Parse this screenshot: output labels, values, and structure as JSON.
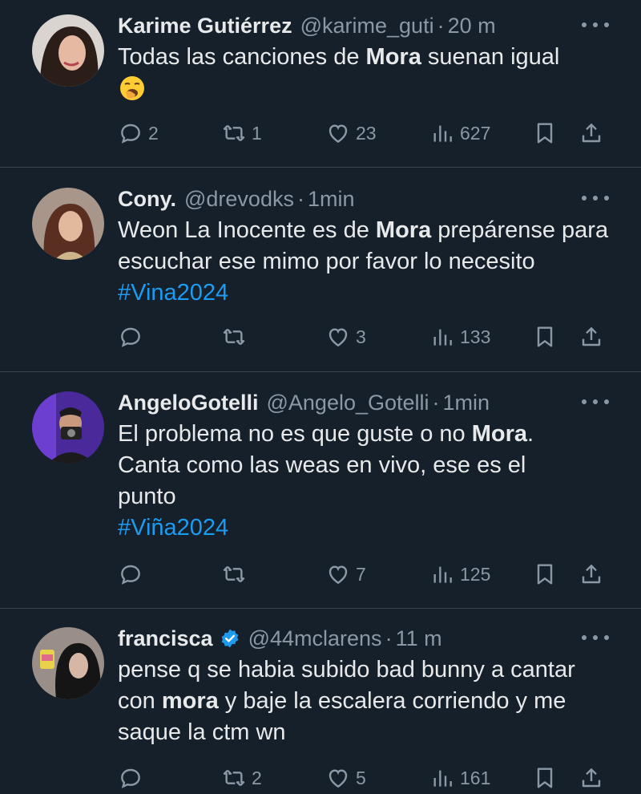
{
  "tweets": [
    {
      "name": "Karime Gutiérrez",
      "handle": "@karime_guti",
      "sep": "·",
      "time": "20 m",
      "verified": false,
      "text_parts": [
        {
          "t": "Todas las canciones de ",
          "s": "normal"
        },
        {
          "t": "Mora",
          "s": "bold"
        },
        {
          "t": " suenan igual",
          "s": "normal"
        }
      ],
      "emoji": "yawning-face-emoji",
      "replies": "2",
      "retweets": "1",
      "likes": "23",
      "views": "627"
    },
    {
      "name": "Cony.",
      "handle": "@drevodks",
      "sep": "·",
      "time": "1min",
      "verified": false,
      "text_parts": [
        {
          "t": "Weon La Inocente es de ",
          "s": "normal"
        },
        {
          "t": "Mora",
          "s": "bold"
        },
        {
          "t": " prepárense para escuchar ese mimo por favor lo necesito  ",
          "s": "normal"
        },
        {
          "t": "#Vina2024",
          "s": "hashtag"
        }
      ],
      "replies": "",
      "retweets": "",
      "likes": "3",
      "views": "133"
    },
    {
      "name": "AngeloGotelli",
      "handle": "@Angelo_Gotelli",
      "sep": "·",
      "time": "1min",
      "verified": false,
      "text_parts": [
        {
          "t": "El problema no es que guste o no ",
          "s": "normal"
        },
        {
          "t": "Mora",
          "s": "bold"
        },
        {
          "t": ". Canta como las weas en vivo, ese es el punto",
          "s": "normal"
        },
        {
          "t": "#Viña2024",
          "s": "hashtag-block"
        }
      ],
      "replies": "",
      "retweets": "",
      "likes": "7",
      "views": "125"
    },
    {
      "name": "francisca",
      "handle": "@44mclarens",
      "sep": "·",
      "time": "11 m",
      "verified": true,
      "text_parts": [
        {
          "t": "pense q se habia subido bad bunny a cantar con ",
          "s": "normal"
        },
        {
          "t": "mora",
          "s": "bold"
        },
        {
          "t": " y baje la escalera corriendo y me saque la ctm wn",
          "s": "normal"
        }
      ],
      "replies": "",
      "retweets": "2",
      "likes": "5",
      "views": "161"
    }
  ],
  "colors": {
    "background": "#15202b",
    "text": "#e7e9ea",
    "muted": "#8b98a5",
    "accent": "#1d9bf0",
    "divider": "#38444d"
  },
  "icons": [
    "reply-icon",
    "retweet-icon",
    "like-icon",
    "views-icon",
    "bookmark-icon",
    "share-icon",
    "more-icon",
    "verified-icon"
  ]
}
